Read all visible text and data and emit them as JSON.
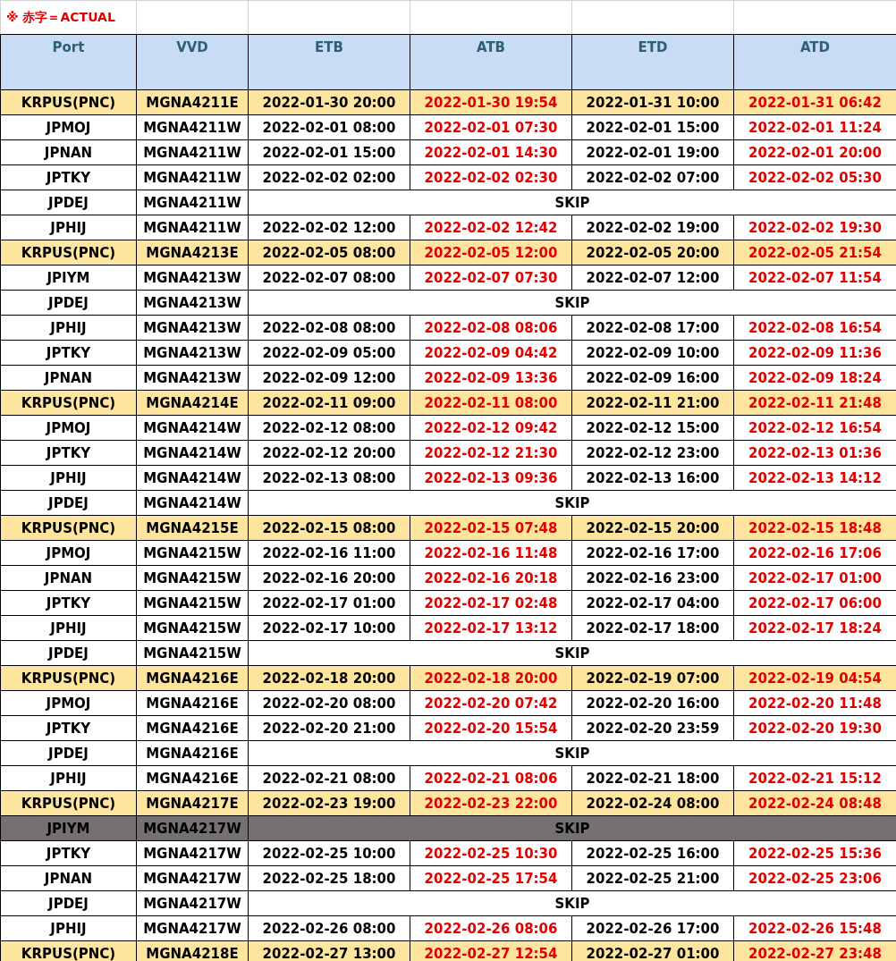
{
  "note": "※ 赤字＝ACTUAL",
  "columns": [
    {
      "label": "Port",
      "actual": false
    },
    {
      "label": "VVD",
      "actual": false
    },
    {
      "label": "ETB",
      "actual": false
    },
    {
      "label": "ATB",
      "actual": true
    },
    {
      "label": "ETD",
      "actual": false
    },
    {
      "label": "ATD",
      "actual": true
    }
  ],
  "rows": [
    {
      "kind": "times",
      "color": "#fde49f",
      "port": "KRPUS(PNC)",
      "vvd": "MGNA4211E",
      "times": [
        "2022-01-30 20:00",
        "2022-01-30 19:54",
        "2022-01-31 10:00",
        "2022-01-31 06:42"
      ]
    },
    {
      "kind": "times",
      "color": "#ffffff",
      "port": "JPMOJ",
      "vvd": "MGNA4211W",
      "times": [
        "2022-02-01 08:00",
        "2022-02-01 07:30",
        "2022-02-01 15:00",
        "2022-02-01 11:24"
      ]
    },
    {
      "kind": "times",
      "color": "#ffffff",
      "port": "JPNAN",
      "vvd": "MGNA4211W",
      "times": [
        "2022-02-01 15:00",
        "2022-02-01 14:30",
        "2022-02-01 19:00",
        "2022-02-01 20:00"
      ]
    },
    {
      "kind": "times",
      "color": "#ffffff",
      "port": "JPTKY",
      "vvd": "MGNA4211W",
      "times": [
        "2022-02-02 02:00",
        "2022-02-02 02:30",
        "2022-02-02 07:00",
        "2022-02-02 05:30"
      ]
    },
    {
      "kind": "skip",
      "color": "#ffffff",
      "port": "JPDEJ",
      "vvd": "MGNA4211W",
      "skip": "SKIP"
    },
    {
      "kind": "times",
      "color": "#ffffff",
      "port": "JPHIJ",
      "vvd": "MGNA4211W",
      "times": [
        "2022-02-02 12:00",
        "2022-02-02 12:42",
        "2022-02-02 19:00",
        "2022-02-02 19:30"
      ]
    },
    {
      "kind": "times",
      "color": "#fde49f",
      "port": "KRPUS(PNC)",
      "vvd": "MGNA4213E",
      "times": [
        "2022-02-05 08:00",
        "2022-02-05 12:00",
        "2022-02-05 20:00",
        "2022-02-05 21:54"
      ]
    },
    {
      "kind": "times",
      "color": "#ffffff",
      "port": "JPIYM",
      "vvd": "MGNA4213W",
      "times": [
        "2022-02-07 08:00",
        "2022-02-07 07:30",
        "2022-02-07 12:00",
        "2022-02-07 11:54"
      ]
    },
    {
      "kind": "skip",
      "color": "#ffffff",
      "port": "JPDEJ",
      "vvd": "MGNA4213W",
      "skip": "SKIP"
    },
    {
      "kind": "times",
      "color": "#ffffff",
      "port": "JPHIJ",
      "vvd": "MGNA4213W",
      "times": [
        "2022-02-08 08:00",
        "2022-02-08 08:06",
        "2022-02-08 17:00",
        "2022-02-08 16:54"
      ]
    },
    {
      "kind": "times",
      "color": "#ffffff",
      "port": "JPTKY",
      "vvd": "MGNA4213W",
      "times": [
        "2022-02-09 05:00",
        "2022-02-09 04:42",
        "2022-02-09 10:00",
        "2022-02-09 11:36"
      ]
    },
    {
      "kind": "times",
      "color": "#ffffff",
      "port": "JPNAN",
      "vvd": "MGNA4213W",
      "times": [
        "2022-02-09 12:00",
        "2022-02-09 13:36",
        "2022-02-09 16:00",
        "2022-02-09 18:24"
      ]
    },
    {
      "kind": "times",
      "color": "#fde49f",
      "port": "KRPUS(PNC)",
      "vvd": "MGNA4214E",
      "times": [
        "2022-02-11 09:00",
        "2022-02-11 08:00",
        "2022-02-11 21:00",
        "2022-02-11 21:48"
      ]
    },
    {
      "kind": "times",
      "color": "#ffffff",
      "port": "JPMOJ",
      "vvd": "MGNA4214W",
      "times": [
        "2022-02-12 08:00",
        "2022-02-12 09:42",
        "2022-02-12 15:00",
        "2022-02-12 16:54"
      ]
    },
    {
      "kind": "times",
      "color": "#ffffff",
      "port": "JPTKY",
      "vvd": "MGNA4214W",
      "times": [
        "2022-02-12 20:00",
        "2022-02-12 21:30",
        "2022-02-12 23:00",
        "2022-02-13 01:36"
      ]
    },
    {
      "kind": "times",
      "color": "#ffffff",
      "port": "JPHIJ",
      "vvd": "MGNA4214W",
      "times": [
        "2022-02-13 08:00",
        "2022-02-13 09:36",
        "2022-02-13 16:00",
        "2022-02-13 14:12"
      ]
    },
    {
      "kind": "skip",
      "color": "#ffffff",
      "port": "JPDEJ",
      "vvd": "MGNA4214W",
      "skip": "SKIP"
    },
    {
      "kind": "times",
      "color": "#fde49f",
      "port": "KRPUS(PNC)",
      "vvd": "MGNA4215E",
      "times": [
        "2022-02-15 08:00",
        "2022-02-15 07:48",
        "2022-02-15 20:00",
        "2022-02-15 18:48"
      ]
    },
    {
      "kind": "times",
      "color": "#ffffff",
      "port": "JPMOJ",
      "vvd": "MGNA4215W",
      "times": [
        "2022-02-16 11:00",
        "2022-02-16 11:48",
        "2022-02-16 17:00",
        "2022-02-16 17:06"
      ]
    },
    {
      "kind": "times",
      "color": "#ffffff",
      "port": "JPNAN",
      "vvd": "MGNA4215W",
      "times": [
        "2022-02-16 20:00",
        "2022-02-16 20:18",
        "2022-02-16 23:00",
        "2022-02-17 01:00"
      ]
    },
    {
      "kind": "times",
      "color": "#ffffff",
      "port": "JPTKY",
      "vvd": "MGNA4215W",
      "times": [
        "2022-02-17 01:00",
        "2022-02-17 02:48",
        "2022-02-17 04:00",
        "2022-02-17 06:00"
      ]
    },
    {
      "kind": "times",
      "color": "#ffffff",
      "port": "JPHIJ",
      "vvd": "MGNA4215W",
      "times": [
        "2022-02-17 10:00",
        "2022-02-17 13:12",
        "2022-02-17 18:00",
        "2022-02-17 18:24"
      ]
    },
    {
      "kind": "skip",
      "color": "#ffffff",
      "port": "JPDEJ",
      "vvd": "MGNA4215W",
      "skip": "SKIP"
    },
    {
      "kind": "times",
      "color": "#fde49f",
      "port": "KRPUS(PNC)",
      "vvd": "MGNA4216E",
      "times": [
        "2022-02-18 20:00",
        "2022-02-18 20:00",
        "2022-02-19 07:00",
        "2022-02-19 04:54"
      ]
    },
    {
      "kind": "times",
      "color": "#ffffff",
      "port": "JPMOJ",
      "vvd": "MGNA4216E",
      "times": [
        "2022-02-20 08:00",
        "2022-02-20 07:42",
        "2022-02-20 16:00",
        "2022-02-20 11:48"
      ]
    },
    {
      "kind": "times",
      "color": "#ffffff",
      "port": "JPTKY",
      "vvd": "MGNA4216E",
      "times": [
        "2022-02-20 21:00",
        "2022-02-20 15:54",
        "2022-02-20 23:59",
        "2022-02-20 19:30"
      ]
    },
    {
      "kind": "skip",
      "color": "#ffffff",
      "port": "JPDEJ",
      "vvd": "MGNA4216E",
      "skip": "SKIP"
    },
    {
      "kind": "times",
      "color": "#ffffff",
      "port": "JPHIJ",
      "vvd": "MGNA4216E",
      "times": [
        "2022-02-21 08:00",
        "2022-02-21 08:06",
        "2022-02-21 18:00",
        "2022-02-21 15:12"
      ]
    },
    {
      "kind": "times",
      "color": "#fde49f",
      "port": "KRPUS(PNC)",
      "vvd": "MGNA4217E",
      "times": [
        "2022-02-23 19:00",
        "2022-02-23 22:00",
        "2022-02-24 08:00",
        "2022-02-24 08:48"
      ]
    },
    {
      "kind": "skip",
      "color": "#767171",
      "port": "JPIYM",
      "vvd": "MGNA4217W",
      "skip": "SKIP"
    },
    {
      "kind": "times",
      "color": "#ffffff",
      "port": "JPTKY",
      "vvd": "MGNA4217W",
      "times": [
        "2022-02-25 10:00",
        "2022-02-25 10:30",
        "2022-02-25 16:00",
        "2022-02-25 15:36"
      ]
    },
    {
      "kind": "times",
      "color": "#ffffff",
      "port": "JPNAN",
      "vvd": "MGNA4217W",
      "times": [
        "2022-02-25 18:00",
        "2022-02-25 17:54",
        "2022-02-25 21:00",
        "2022-02-25 23:06"
      ]
    },
    {
      "kind": "skip",
      "color": "#ffffff",
      "port": "JPDEJ",
      "vvd": "MGNA4217W",
      "skip": "SKIP"
    },
    {
      "kind": "times",
      "color": "#ffffff",
      "port": "JPHIJ",
      "vvd": "MGNA4217W",
      "times": [
        "2022-02-26 08:00",
        "2022-02-26 08:06",
        "2022-02-26 17:00",
        "2022-02-26 15:48"
      ]
    },
    {
      "kind": "times",
      "color": "#fde49f",
      "port": "KRPUS(PNC)",
      "vvd": "MGNA4218E",
      "times": [
        "2022-02-27 13:00",
        "2022-02-27 12:54",
        "2022-02-27 01:00",
        "2022-02-27 23:48"
      ]
    }
  ]
}
